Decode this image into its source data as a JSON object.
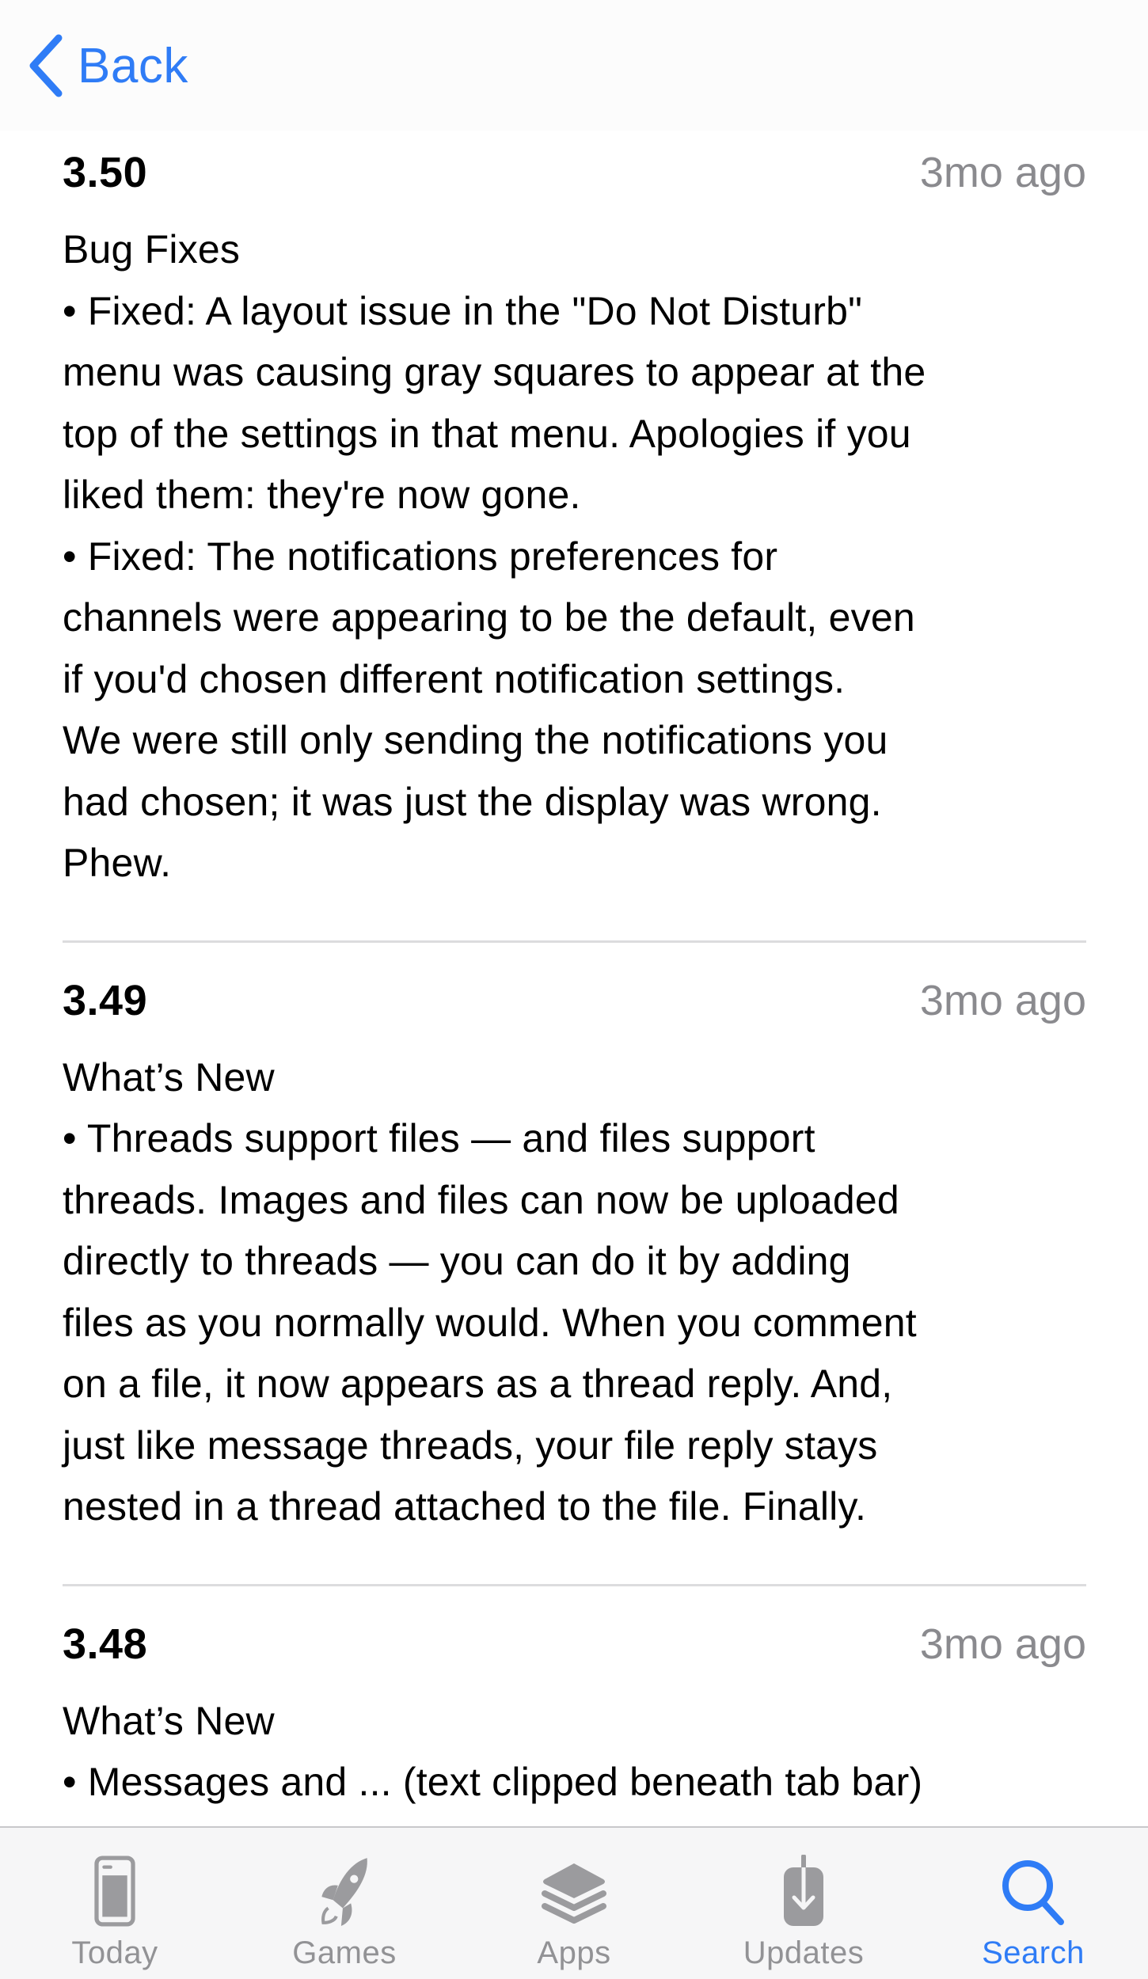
{
  "header": {
    "back_label": "Back"
  },
  "colors": {
    "accent": "#2f7cf6",
    "inactive": "#9b9b9e",
    "secondary_text": "#8a8a8e"
  },
  "entries": [
    {
      "version": "3.50",
      "date": "3mo ago",
      "notes": "Bug Fixes\n• Fixed: A layout issue in the \"Do Not Disturb\"\nmenu was causing gray squares to appear at the\ntop of the settings in that menu. Apologies if you\nliked them: they're now gone.\n• Fixed: The notifications preferences for\nchannels were appearing to be the default, even\nif you'd chosen different notification settings.\nWe were still only sending the notifications you\nhad chosen; it was just the display was wrong.\nPhew."
    },
    {
      "version": "3.49",
      "date": "3mo ago",
      "notes": "What’s New\n• Threads support files — and files support\nthreads. Images and files can now be uploaded\ndirectly to threads — you can do it by adding\nfiles as you normally would. When you comment\non a file, it now appears as a thread reply. And,\njust like message threads, your file reply stays\nnested in a thread attached to the file. Finally."
    },
    {
      "version": "3.48",
      "date": "3mo ago",
      "notes": "What’s New\n• Messages and ... (text clipped beneath tab bar)"
    }
  ],
  "tabbar": {
    "tabs": [
      {
        "label": "Today",
        "icon": "today-icon",
        "active": false
      },
      {
        "label": "Games",
        "icon": "rocket-icon",
        "active": false
      },
      {
        "label": "Apps",
        "icon": "layers-icon",
        "active": false
      },
      {
        "label": "Updates",
        "icon": "download-icon",
        "active": false
      },
      {
        "label": "Search",
        "icon": "search-icon",
        "active": true
      }
    ]
  }
}
